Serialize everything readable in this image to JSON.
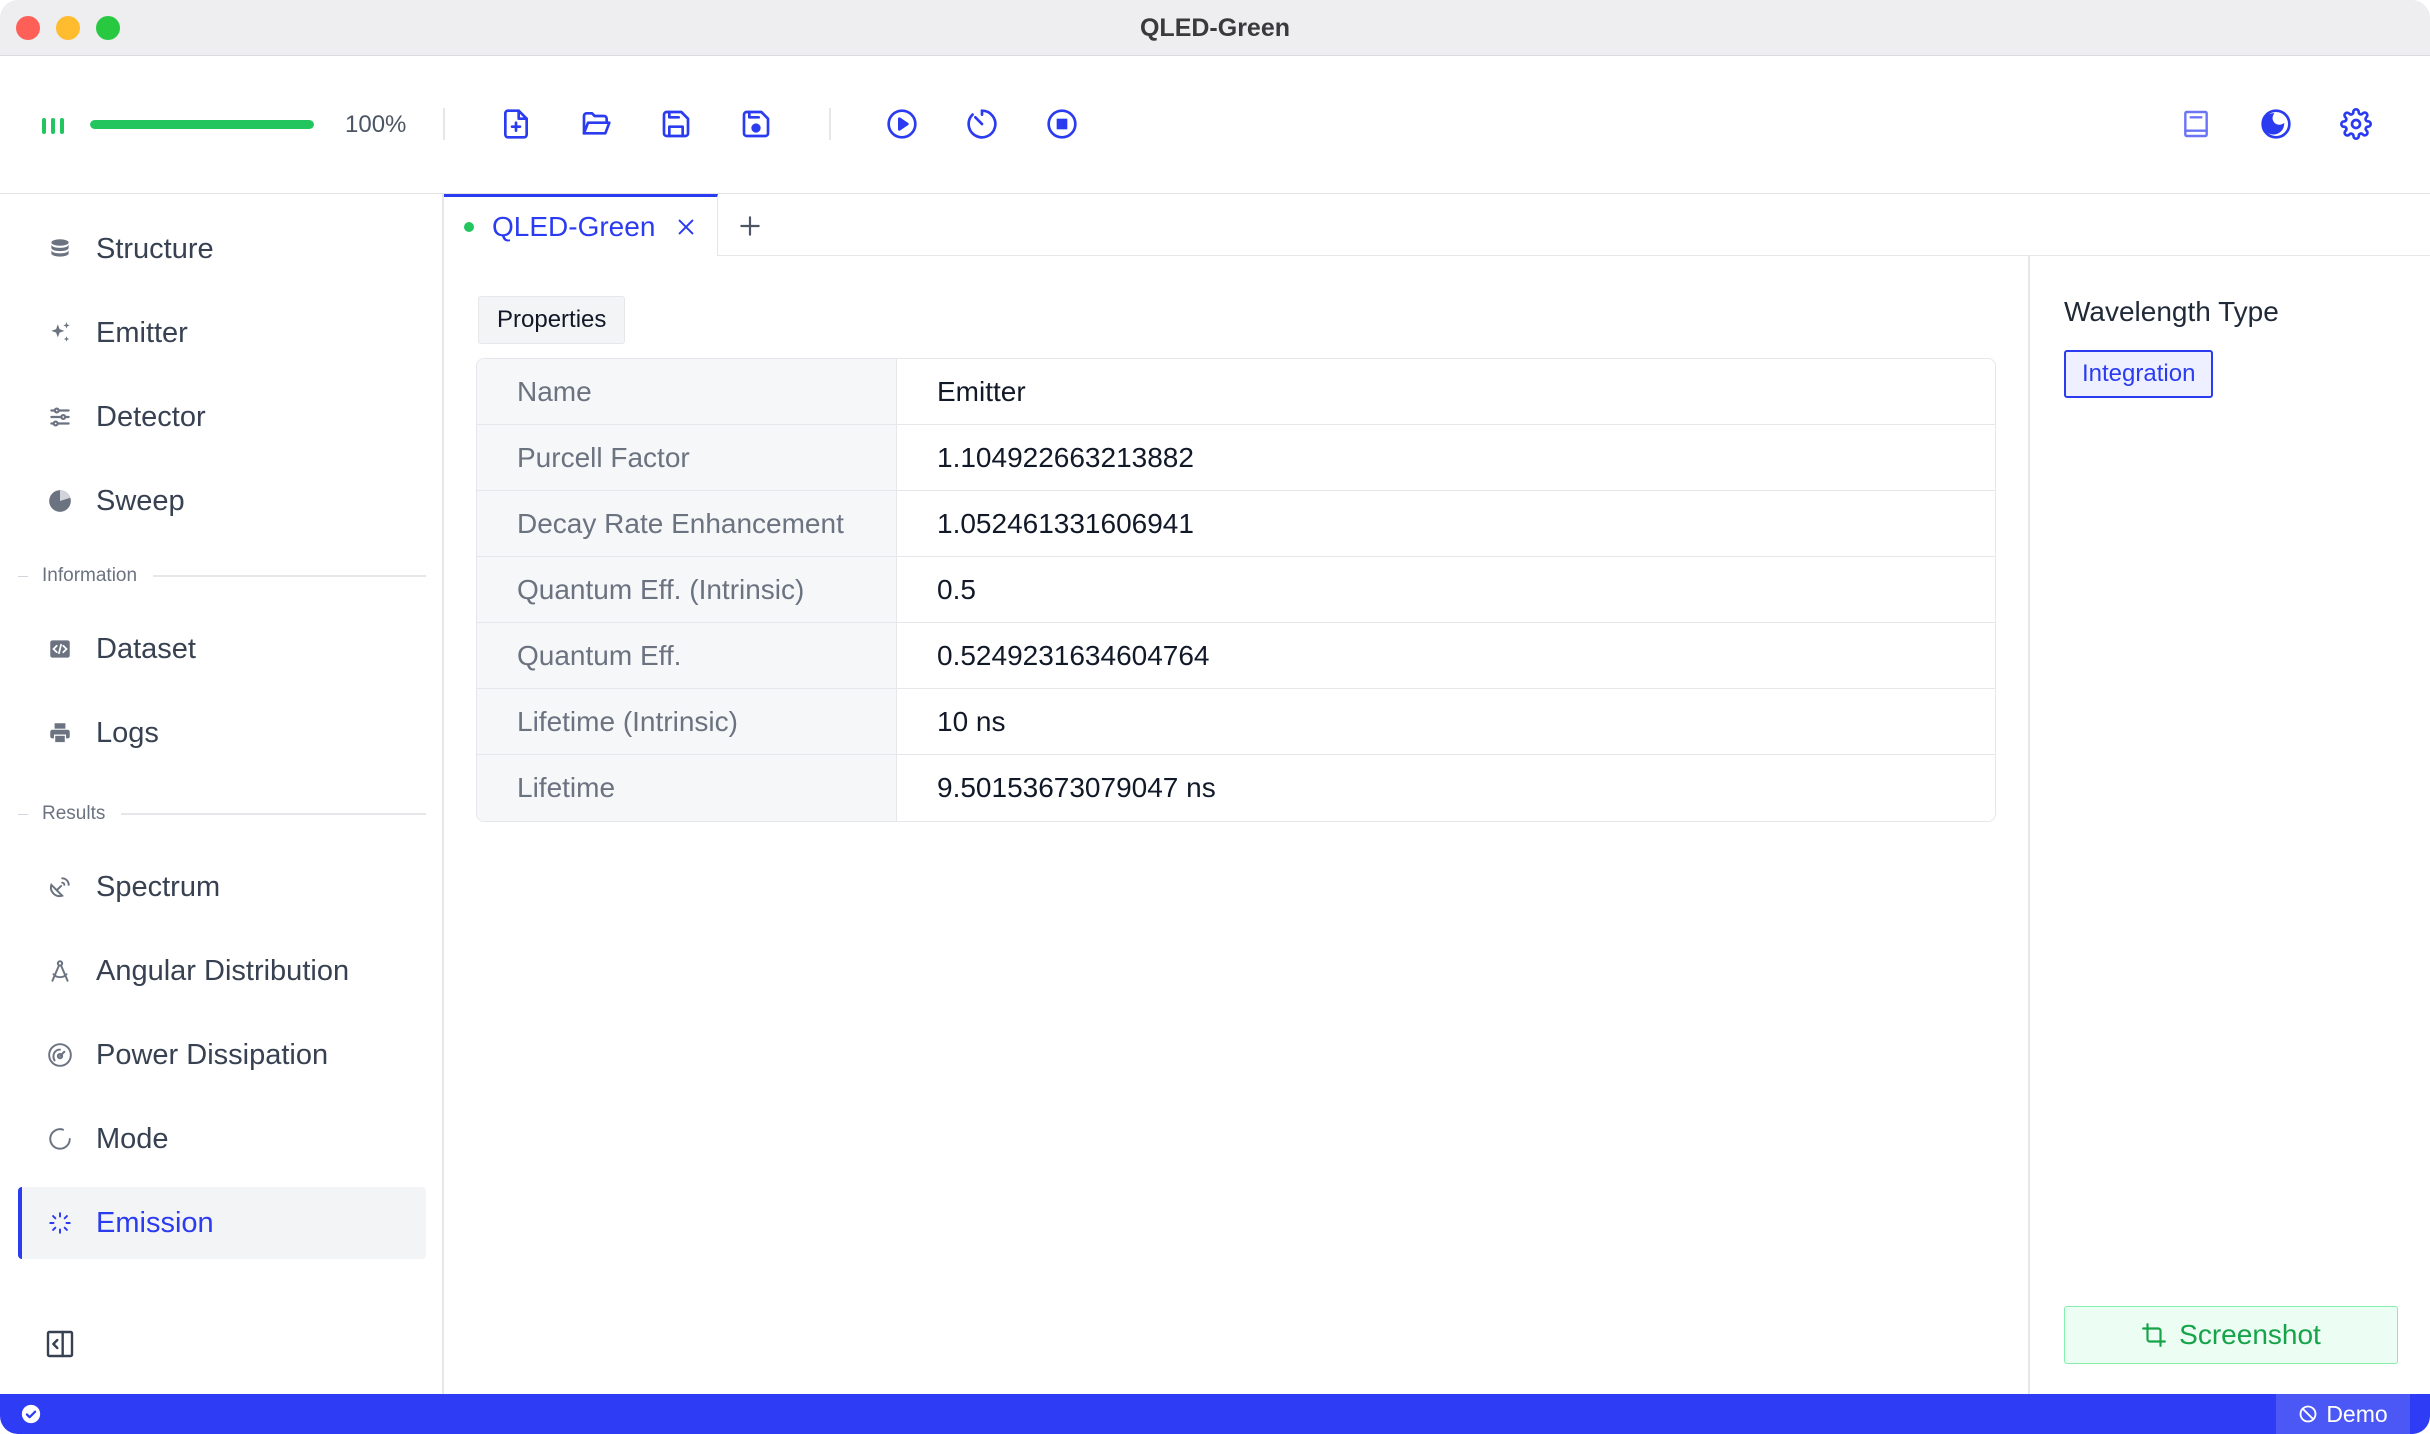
{
  "window": {
    "title": "QLED-Green"
  },
  "toolbar": {
    "progress_percent": 100,
    "progress_label": "100%",
    "accent_color": "#22c55e",
    "left_buttons": [
      "new-file-icon",
      "open-folder-icon",
      "save-icon",
      "save-as-icon"
    ],
    "run_buttons": [
      "play-icon",
      "timer-icon",
      "stop-icon"
    ],
    "right_buttons": [
      "book-icon",
      "theme-icon",
      "gear-icon"
    ]
  },
  "sidebar": {
    "primary": [
      {
        "label": "Structure",
        "icon": "database-icon"
      },
      {
        "label": "Emitter",
        "icon": "sparkles-icon"
      },
      {
        "label": "Detector",
        "icon": "sliders-icon"
      },
      {
        "label": "Sweep",
        "icon": "pie-icon"
      }
    ],
    "section_information": "Information",
    "information": [
      {
        "label": "Dataset",
        "icon": "code-file-icon"
      },
      {
        "label": "Logs",
        "icon": "printer-icon"
      }
    ],
    "section_results": "Results",
    "results": [
      {
        "label": "Spectrum",
        "icon": "satellite-dish-icon"
      },
      {
        "label": "Angular Distribution",
        "icon": "compass-icon"
      },
      {
        "label": "Power Dissipation",
        "icon": "gauge-icon"
      },
      {
        "label": "Mode",
        "icon": "loader-circle-icon"
      },
      {
        "label": "Emission",
        "icon": "loader-spark-icon",
        "active": true
      }
    ]
  },
  "tabs": [
    {
      "label": "QLED-Green",
      "active": true
    }
  ],
  "main": {
    "section_label": "Properties",
    "properties": [
      {
        "key": "Name",
        "value": "Emitter"
      },
      {
        "key": "Purcell Factor",
        "value": "1.104922663213882"
      },
      {
        "key": "Decay Rate Enhancement",
        "value": "1.052461331606941"
      },
      {
        "key": "Quantum Eff. (Intrinsic)",
        "value": "0.5"
      },
      {
        "key": "Quantum Eff.",
        "value": "0.5249231634604764"
      },
      {
        "key": "Lifetime (Intrinsic)",
        "value": "10 ns"
      },
      {
        "key": "Lifetime",
        "value": "9.50153673079047 ns"
      }
    ]
  },
  "right_panel": {
    "title": "Wavelength Type",
    "selected_option": "Integration",
    "screenshot_label": "Screenshot"
  },
  "statusbar": {
    "color": "#2f3cf5",
    "demo_label": "Demo"
  }
}
